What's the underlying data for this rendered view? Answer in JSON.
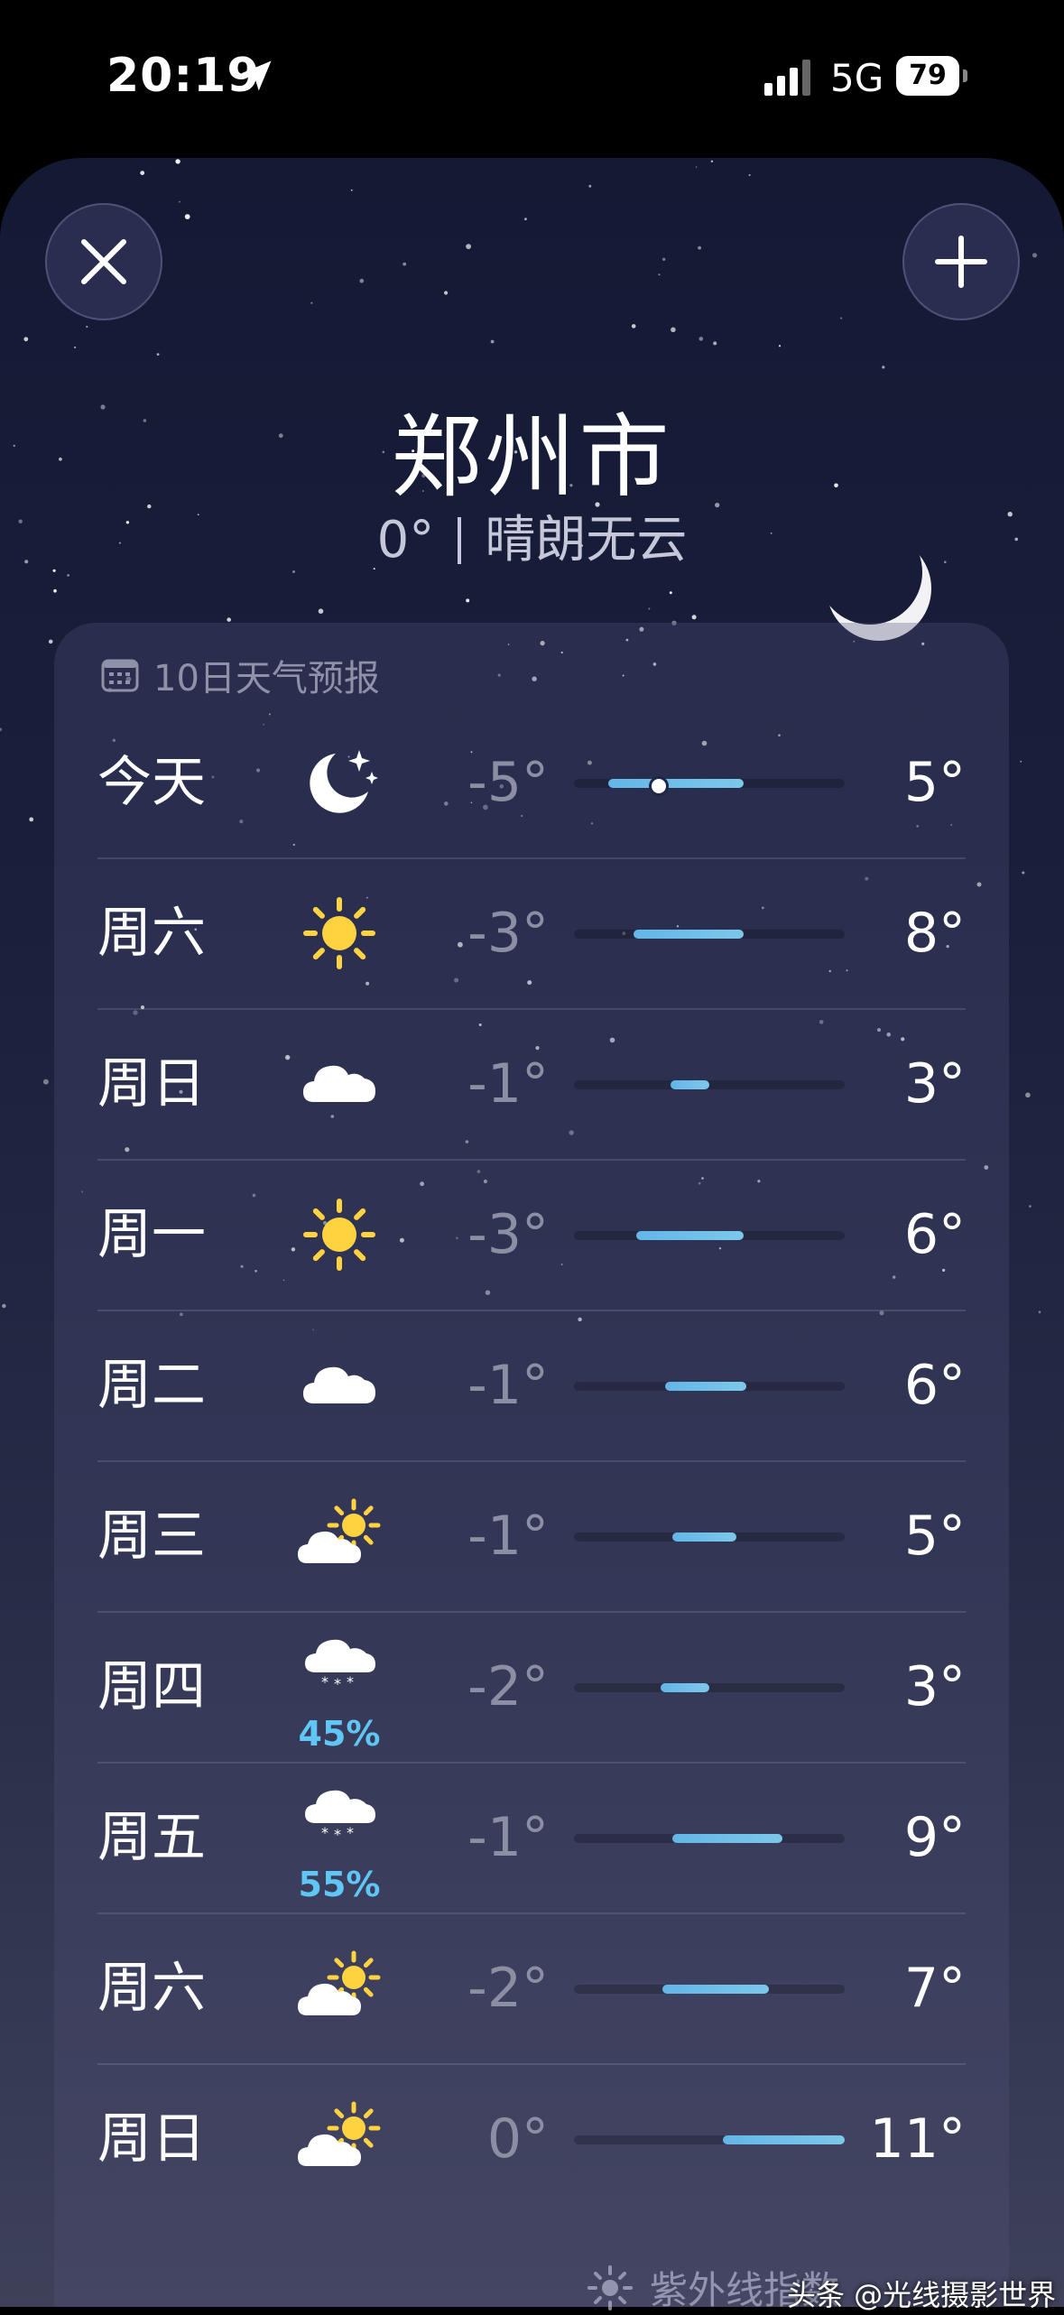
{
  "status_bar": {
    "time": "20:19",
    "network": "5G",
    "battery": "79"
  },
  "header": {
    "city": "郑州市",
    "temperature": "0°",
    "condition": "晴朗无云"
  },
  "forecast": {
    "title": "10日天气预报",
    "range_min": -5,
    "range_max": 11,
    "days": [
      {
        "day": "今天",
        "icon": "moon-stars-icon",
        "low": "-5°",
        "high": "5°",
        "bar": [
          -3,
          5
        ],
        "current": 0
      },
      {
        "day": "周六",
        "icon": "sun-icon",
        "low": "-3°",
        "high": "8°",
        "bar": [
          -1.5,
          5
        ]
      },
      {
        "day": "周日",
        "icon": "cloud-icon",
        "low": "-1°",
        "high": "3°",
        "bar": [
          0.7,
          3
        ]
      },
      {
        "day": "周一",
        "icon": "sun-icon",
        "low": "-3°",
        "high": "6°",
        "bar": [
          -1.3,
          5
        ]
      },
      {
        "day": "周二",
        "icon": "cloud-icon",
        "low": "-1°",
        "high": "6°",
        "bar": [
          0.4,
          5.2
        ]
      },
      {
        "day": "周三",
        "icon": "partly-cloudy-icon",
        "low": "-1°",
        "high": "5°",
        "bar": [
          0.8,
          4.6
        ]
      },
      {
        "day": "周四",
        "icon": "snow-icon",
        "precip": "45%",
        "low": "-2°",
        "high": "3°",
        "bar": [
          0.1,
          3
        ]
      },
      {
        "day": "周五",
        "icon": "snow-icon",
        "precip": "55%",
        "low": "-1°",
        "high": "9°",
        "bar": [
          0.8,
          7.3
        ]
      },
      {
        "day": "周六",
        "icon": "partly-cloudy-icon",
        "low": "-2°",
        "high": "7°",
        "bar": [
          0.2,
          6.5
        ]
      },
      {
        "day": "周日",
        "icon": "partly-cloudy-icon",
        "low": "0°",
        "high": "11°",
        "bar": [
          3.8,
          11
        ]
      }
    ]
  },
  "watermark": {
    "uv_text": "紫外线指数",
    "source": "头条 @光线摄影世界"
  },
  "colors": {
    "precip": "#5fc6f5",
    "bar": "#63b6e8",
    "sun": "#ffd23f"
  }
}
